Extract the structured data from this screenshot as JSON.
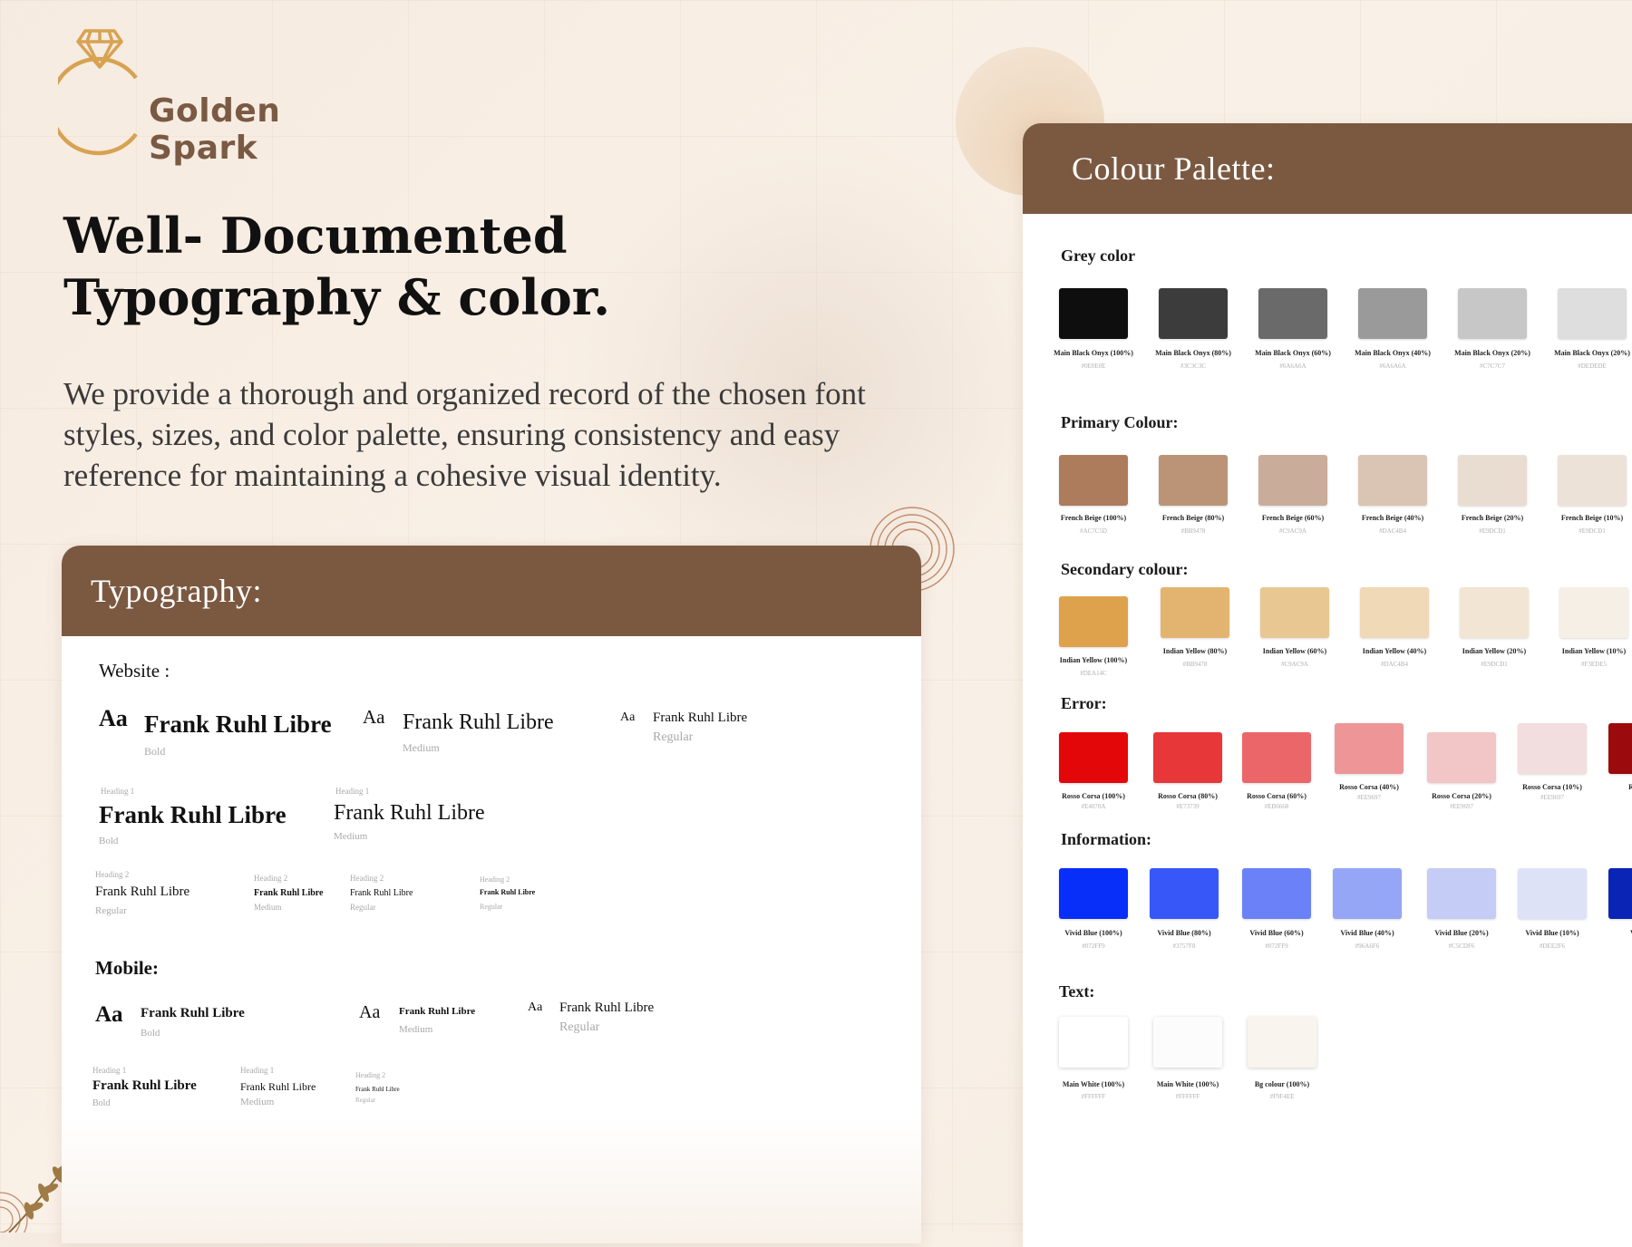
{
  "brand": {
    "name": "Golden Spark"
  },
  "hero": {
    "title": "Well- Documented Typography & color.",
    "description": "We provide a thorough and organized record of the chosen font styles, sizes, and color palette, ensuring consistency and easy reference for maintaining a cohesive visual identity."
  },
  "typography": {
    "title": "Typography:",
    "website_label": "Website :",
    "mobile_label": "Mobile:",
    "font": "Frank Ruhl Libre",
    "aa": "Aa",
    "weights": {
      "bold": "Bold",
      "medium": "Medium",
      "regular": "Regular"
    },
    "headings": {
      "h1": "Heading 1",
      "h2": "Heading 2"
    }
  },
  "palette": {
    "title": "Colour Palette:",
    "sections": {
      "grey": {
        "title": "Grey color",
        "swatches": [
          {
            "name": "Main Black Onyx (100%)",
            "hex": "#0E0E0E",
            "color": "#0e0e0e"
          },
          {
            "name": "Main Black Onyx (80%)",
            "hex": "#3C3C3C",
            "color": "#3c3c3c"
          },
          {
            "name": "Main Black Onyx (60%)",
            "hex": "#6A6A6A",
            "color": "#6a6a6a"
          },
          {
            "name": "Main Black Onyx (40%)",
            "hex": "#6A6A6A",
            "color": "#9a9a9a"
          },
          {
            "name": "Main Black Onyx (20%)",
            "hex": "#C7C7C7",
            "color": "#c7c7c7"
          },
          {
            "name": "Main Black Onyx (20%)",
            "hex": "#DEDEDE",
            "color": "#dedede"
          }
        ]
      },
      "primary": {
        "title": "Primary Colour:",
        "swatches": [
          {
            "name": "French Beige (100%)",
            "hex": "#AC7C5D",
            "color": "#ac7c5d"
          },
          {
            "name": "French Beige (80%)",
            "hex": "#BB9478",
            "color": "#bb9478"
          },
          {
            "name": "French Beige (60%)",
            "hex": "#C9AC9A",
            "color": "#c9ac9a"
          },
          {
            "name": "French Beige (40%)",
            "hex": "#DAC4B4",
            "color": "#dac4b4"
          },
          {
            "name": "French Beige (20%)",
            "hex": "#E9DCD1",
            "color": "#e9dcd1"
          },
          {
            "name": "French Beige (10%)",
            "hex": "#E9DCD1",
            "color": "#ede2d8"
          }
        ]
      },
      "secondary": {
        "title": "Secondary colour:",
        "swatches": [
          {
            "name": "Indian Yellow (100%)",
            "hex": "#DEA14C",
            "color": "#dea14c"
          },
          {
            "name": "Indian Yellow (80%)",
            "hex": "#BB9478",
            "color": "#e3b46f"
          },
          {
            "name": "Indian Yellow (60%)",
            "hex": "#C9AC9A",
            "color": "#e9c792"
          },
          {
            "name": "Indian Yellow (40%)",
            "hex": "#DAC4B4",
            "color": "#efd9b7"
          },
          {
            "name": "Indian Yellow (20%)",
            "hex": "#E9DCD1",
            "color": "#f2e5d3"
          },
          {
            "name": "Indian Yellow (10%)",
            "hex": "#F3EDE5",
            "color": "#f6efe6"
          }
        ]
      },
      "error": {
        "title": "Error:",
        "swatches": [
          {
            "name": "Rosso Corsa (100%)",
            "hex": "#E4070A",
            "color": "#e4070a"
          },
          {
            "name": "Rosso Corsa (80%)",
            "hex": "#E73739",
            "color": "#e73739"
          },
          {
            "name": "Rosso Corsa (60%)",
            "hex": "#EB6668",
            "color": "#eb6668"
          },
          {
            "name": "Rosso Corsa (40%)",
            "hex": "#EE9697",
            "color": "#ee9697"
          },
          {
            "name": "Rosso Corsa (20%)",
            "hex": "#EE9697",
            "color": "#f2c6c7"
          },
          {
            "name": "Rosso Corsa (10%)",
            "hex": "#EE9697",
            "color": "#f3dedf"
          },
          {
            "name": "Rosso Co",
            "hex": "",
            "color": "#9b0a0d"
          }
        ]
      },
      "information": {
        "title": "Information:",
        "swatches": [
          {
            "name": "Vivid Blue (100%)",
            "hex": "#072FF9",
            "color": "#072ff9"
          },
          {
            "name": "Vivid Blue (80%)",
            "hex": "#3757F8",
            "color": "#3757f8"
          },
          {
            "name": "Vivid Blue (60%)",
            "hex": "#072FF9",
            "color": "#6a81f8"
          },
          {
            "name": "Vivid Blue (40%)",
            "hex": "#96A6F6",
            "color": "#96a6f6"
          },
          {
            "name": "Vivid Blue (20%)",
            "hex": "#C5CDF6",
            "color": "#c5cdf6"
          },
          {
            "name": "Vivid Blue (10%)",
            "hex": "#DEE2F6",
            "color": "#dee2f6"
          },
          {
            "name": "Vivid Bl",
            "hex": "",
            "color": "#0a24b5"
          }
        ]
      },
      "text": {
        "title": "Text:",
        "swatches": [
          {
            "name": "Main White (100%)",
            "hex": "#FFFFFF",
            "color": "#ffffff"
          },
          {
            "name": "Main White (100%)",
            "hex": "#FFFFFF",
            "color": "#fcfcfd"
          },
          {
            "name": "Bg colour (100%)",
            "hex": "#F9F4EE",
            "color": "#f9f4ee"
          }
        ]
      }
    }
  }
}
